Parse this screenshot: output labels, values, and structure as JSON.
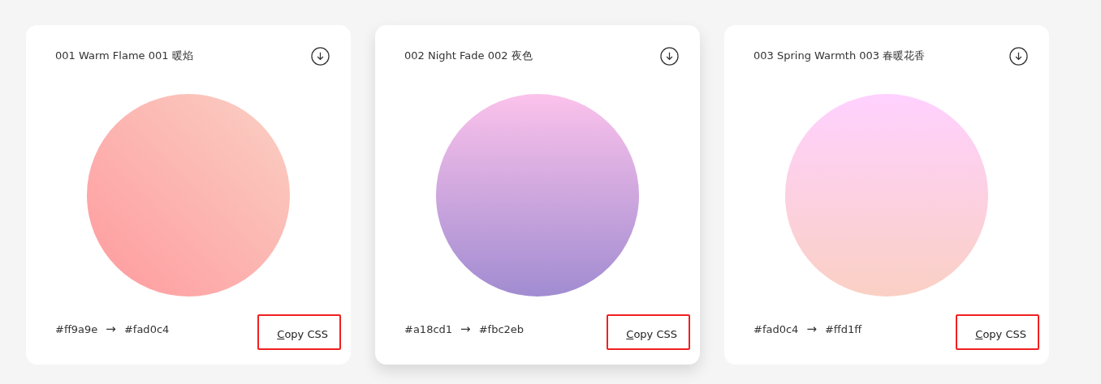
{
  "cards": [
    {
      "title": "001 Warm Flame 001 暖焰",
      "from": "#ff9a9e",
      "arrow": "→",
      "to": "#fad0c4",
      "kind": "diagonal",
      "raised": false,
      "button": "Copy CSS"
    },
    {
      "title": "002 Night Fade 002 夜色",
      "from": "#a18cd1",
      "arrow": "→",
      "to": "#fbc2eb",
      "kind": "vertical",
      "raised": true,
      "button": "Copy CSS"
    },
    {
      "title": "003 Spring Warmth 003 春暖花香",
      "from": "#fad0c4",
      "arrow": "→",
      "to": "#ffd1ff",
      "kind": "vertical",
      "raised": false,
      "button": "Copy CSS"
    }
  ]
}
